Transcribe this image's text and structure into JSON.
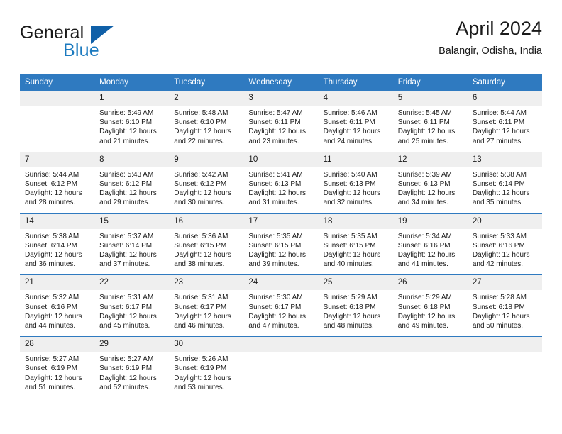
{
  "brand": {
    "general": "General",
    "blue": "Blue",
    "triangle_color": "#1060a8",
    "blue_color": "#1b7abf"
  },
  "header": {
    "title": "April 2024",
    "subtitle": "Balangir, Odisha, India"
  },
  "theme": {
    "header_blue": "#2f7ac0",
    "daynum_gray": "#efefef",
    "text": "#1a1a1a"
  },
  "weekdays": [
    "Sunday",
    "Monday",
    "Tuesday",
    "Wednesday",
    "Thursday",
    "Friday",
    "Saturday"
  ],
  "weeks": [
    [
      {
        "day": "",
        "lines": [],
        "empty": true
      },
      {
        "day": "1",
        "lines": [
          "Sunrise: 5:49 AM",
          "Sunset: 6:10 PM",
          "Daylight: 12 hours",
          "and 21 minutes."
        ]
      },
      {
        "day": "2",
        "lines": [
          "Sunrise: 5:48 AM",
          "Sunset: 6:10 PM",
          "Daylight: 12 hours",
          "and 22 minutes."
        ]
      },
      {
        "day": "3",
        "lines": [
          "Sunrise: 5:47 AM",
          "Sunset: 6:11 PM",
          "Daylight: 12 hours",
          "and 23 minutes."
        ]
      },
      {
        "day": "4",
        "lines": [
          "Sunrise: 5:46 AM",
          "Sunset: 6:11 PM",
          "Daylight: 12 hours",
          "and 24 minutes."
        ]
      },
      {
        "day": "5",
        "lines": [
          "Sunrise: 5:45 AM",
          "Sunset: 6:11 PM",
          "Daylight: 12 hours",
          "and 25 minutes."
        ]
      },
      {
        "day": "6",
        "lines": [
          "Sunrise: 5:44 AM",
          "Sunset: 6:11 PM",
          "Daylight: 12 hours",
          "and 27 minutes."
        ]
      }
    ],
    [
      {
        "day": "7",
        "lines": [
          "Sunrise: 5:44 AM",
          "Sunset: 6:12 PM",
          "Daylight: 12 hours",
          "and 28 minutes."
        ]
      },
      {
        "day": "8",
        "lines": [
          "Sunrise: 5:43 AM",
          "Sunset: 6:12 PM",
          "Daylight: 12 hours",
          "and 29 minutes."
        ]
      },
      {
        "day": "9",
        "lines": [
          "Sunrise: 5:42 AM",
          "Sunset: 6:12 PM",
          "Daylight: 12 hours",
          "and 30 minutes."
        ]
      },
      {
        "day": "10",
        "lines": [
          "Sunrise: 5:41 AM",
          "Sunset: 6:13 PM",
          "Daylight: 12 hours",
          "and 31 minutes."
        ]
      },
      {
        "day": "11",
        "lines": [
          "Sunrise: 5:40 AM",
          "Sunset: 6:13 PM",
          "Daylight: 12 hours",
          "and 32 minutes."
        ]
      },
      {
        "day": "12",
        "lines": [
          "Sunrise: 5:39 AM",
          "Sunset: 6:13 PM",
          "Daylight: 12 hours",
          "and 34 minutes."
        ]
      },
      {
        "day": "13",
        "lines": [
          "Sunrise: 5:38 AM",
          "Sunset: 6:14 PM",
          "Daylight: 12 hours",
          "and 35 minutes."
        ]
      }
    ],
    [
      {
        "day": "14",
        "lines": [
          "Sunrise: 5:38 AM",
          "Sunset: 6:14 PM",
          "Daylight: 12 hours",
          "and 36 minutes."
        ]
      },
      {
        "day": "15",
        "lines": [
          "Sunrise: 5:37 AM",
          "Sunset: 6:14 PM",
          "Daylight: 12 hours",
          "and 37 minutes."
        ]
      },
      {
        "day": "16",
        "lines": [
          "Sunrise: 5:36 AM",
          "Sunset: 6:15 PM",
          "Daylight: 12 hours",
          "and 38 minutes."
        ]
      },
      {
        "day": "17",
        "lines": [
          "Sunrise: 5:35 AM",
          "Sunset: 6:15 PM",
          "Daylight: 12 hours",
          "and 39 minutes."
        ]
      },
      {
        "day": "18",
        "lines": [
          "Sunrise: 5:35 AM",
          "Sunset: 6:15 PM",
          "Daylight: 12 hours",
          "and 40 minutes."
        ]
      },
      {
        "day": "19",
        "lines": [
          "Sunrise: 5:34 AM",
          "Sunset: 6:16 PM",
          "Daylight: 12 hours",
          "and 41 minutes."
        ]
      },
      {
        "day": "20",
        "lines": [
          "Sunrise: 5:33 AM",
          "Sunset: 6:16 PM",
          "Daylight: 12 hours",
          "and 42 minutes."
        ]
      }
    ],
    [
      {
        "day": "21",
        "lines": [
          "Sunrise: 5:32 AM",
          "Sunset: 6:16 PM",
          "Daylight: 12 hours",
          "and 44 minutes."
        ]
      },
      {
        "day": "22",
        "lines": [
          "Sunrise: 5:31 AM",
          "Sunset: 6:17 PM",
          "Daylight: 12 hours",
          "and 45 minutes."
        ]
      },
      {
        "day": "23",
        "lines": [
          "Sunrise: 5:31 AM",
          "Sunset: 6:17 PM",
          "Daylight: 12 hours",
          "and 46 minutes."
        ]
      },
      {
        "day": "24",
        "lines": [
          "Sunrise: 5:30 AM",
          "Sunset: 6:17 PM",
          "Daylight: 12 hours",
          "and 47 minutes."
        ]
      },
      {
        "day": "25",
        "lines": [
          "Sunrise: 5:29 AM",
          "Sunset: 6:18 PM",
          "Daylight: 12 hours",
          "and 48 minutes."
        ]
      },
      {
        "day": "26",
        "lines": [
          "Sunrise: 5:29 AM",
          "Sunset: 6:18 PM",
          "Daylight: 12 hours",
          "and 49 minutes."
        ]
      },
      {
        "day": "27",
        "lines": [
          "Sunrise: 5:28 AM",
          "Sunset: 6:18 PM",
          "Daylight: 12 hours",
          "and 50 minutes."
        ]
      }
    ],
    [
      {
        "day": "28",
        "lines": [
          "Sunrise: 5:27 AM",
          "Sunset: 6:19 PM",
          "Daylight: 12 hours",
          "and 51 minutes."
        ]
      },
      {
        "day": "29",
        "lines": [
          "Sunrise: 5:27 AM",
          "Sunset: 6:19 PM",
          "Daylight: 12 hours",
          "and 52 minutes."
        ]
      },
      {
        "day": "30",
        "lines": [
          "Sunrise: 5:26 AM",
          "Sunset: 6:19 PM",
          "Daylight: 12 hours",
          "and 53 minutes."
        ]
      },
      {
        "day": "",
        "lines": [],
        "empty": true
      },
      {
        "day": "",
        "lines": [],
        "empty": true
      },
      {
        "day": "",
        "lines": [],
        "empty": true
      },
      {
        "day": "",
        "lines": [],
        "empty": true
      }
    ]
  ]
}
